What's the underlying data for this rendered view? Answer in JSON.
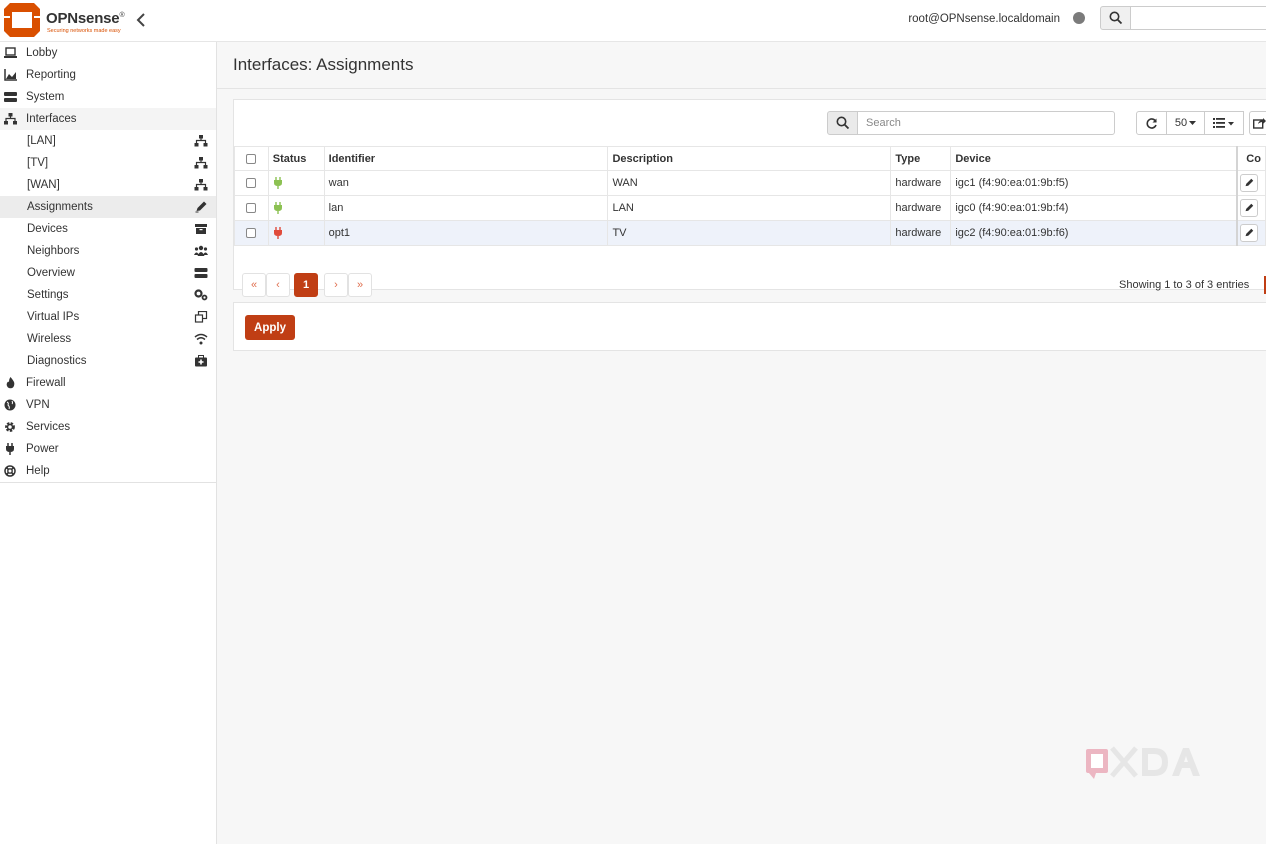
{
  "header": {
    "logo_text": "OPNsense",
    "logo_mark": "®",
    "tagline": "Securing networks made easy",
    "user": "root@OPNsense.localdomain",
    "search_placeholder": ""
  },
  "sidebar": {
    "items": [
      {
        "label": "Lobby",
        "icon": "laptop-icon"
      },
      {
        "label": "Reporting",
        "icon": "area-chart-icon"
      },
      {
        "label": "System",
        "icon": "server-icon"
      },
      {
        "label": "Interfaces",
        "icon": "sitemap-icon"
      },
      {
        "label": "[LAN]",
        "icon": "sitemap-icon"
      },
      {
        "label": "[TV]",
        "icon": "sitemap-icon"
      },
      {
        "label": "[WAN]",
        "icon": "sitemap-icon"
      },
      {
        "label": "Assignments",
        "icon": "pencil-icon"
      },
      {
        "label": "Devices",
        "icon": "archive-icon"
      },
      {
        "label": "Neighbors",
        "icon": "users-icon"
      },
      {
        "label": "Overview",
        "icon": "tasks-icon"
      },
      {
        "label": "Settings",
        "icon": "cogs-icon"
      },
      {
        "label": "Virtual IPs",
        "icon": "clone-icon"
      },
      {
        "label": "Wireless",
        "icon": "wifi-icon"
      },
      {
        "label": "Diagnostics",
        "icon": "medkit-icon"
      },
      {
        "label": "Firewall",
        "icon": "fire-icon"
      },
      {
        "label": "VPN",
        "icon": "globe-icon"
      },
      {
        "label": "Services",
        "icon": "cog-icon"
      },
      {
        "label": "Power",
        "icon": "plug-icon"
      },
      {
        "label": "Help",
        "icon": "life-ring-icon"
      }
    ]
  },
  "page": {
    "title": "Interfaces: Assignments"
  },
  "grid": {
    "search_placeholder": "Search",
    "rows_per_page": "50",
    "columns": [
      "Status",
      "Identifier",
      "Description",
      "Type",
      "Device",
      "Co"
    ],
    "rows": [
      {
        "status": "up",
        "identifier": "wan",
        "description": "WAN",
        "type": "hardware",
        "device": "igc1 (f4:90:ea:01:9b:f5)"
      },
      {
        "status": "up",
        "identifier": "lan",
        "description": "LAN",
        "type": "hardware",
        "device": "igc0 (f4:90:ea:01:9b:f4)"
      },
      {
        "status": "down",
        "identifier": "opt1",
        "description": "TV",
        "type": "hardware",
        "device": "igc2 (f4:90:ea:01:9b:f6)"
      }
    ],
    "pager": {
      "first": "«",
      "prev": "‹",
      "current": "1",
      "next": "›",
      "last": "»"
    },
    "info": "Showing 1 to 3 of 3 entries"
  },
  "actions": {
    "apply_label": "Apply"
  },
  "watermark": {
    "text": "XDA"
  },
  "colors": {
    "accent": "#c03e14",
    "status_up": "#8cc152",
    "status_down": "#e04b3b",
    "row_highlight": "#eef2fa"
  }
}
